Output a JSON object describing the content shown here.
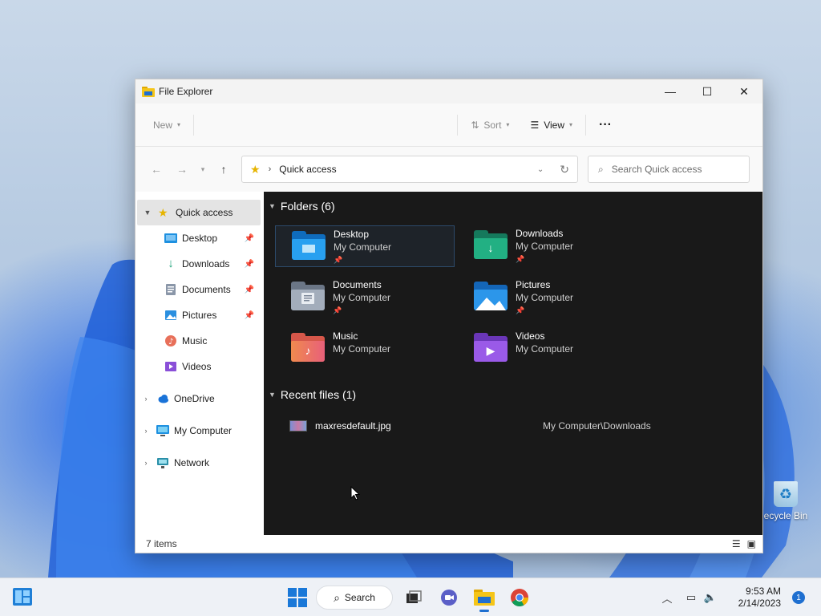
{
  "window": {
    "title": "File Explorer",
    "controls": {
      "minimize": "—",
      "maximize": "☐",
      "close": "✕"
    }
  },
  "toolbar": {
    "new_label": "New",
    "sort_label": "Sort",
    "view_label": "View",
    "more_label": "···"
  },
  "address_bar": {
    "location": "Quick access",
    "search_placeholder": "Search Quick access"
  },
  "sidebar": {
    "quick_access": "Quick access",
    "pinned": [
      {
        "label": "Desktop",
        "icon": "desktop-icon",
        "pinned": true
      },
      {
        "label": "Downloads",
        "icon": "downloads-icon",
        "pinned": true
      },
      {
        "label": "Documents",
        "icon": "documents-icon",
        "pinned": true
      },
      {
        "label": "Pictures",
        "icon": "pictures-icon",
        "pinned": true
      },
      {
        "label": "Music",
        "icon": "music-icon",
        "pinned": false
      },
      {
        "label": "Videos",
        "icon": "videos-icon",
        "pinned": false
      }
    ],
    "onedrive": "OneDrive",
    "my_computer": "My Computer",
    "network": "Network"
  },
  "content": {
    "folders_header": "Folders (6)",
    "folders": [
      {
        "name": "Desktop",
        "location": "My Computer",
        "pinned": true,
        "color": "#1e90e0"
      },
      {
        "name": "Downloads",
        "location": "My Computer",
        "pinned": true,
        "color": "#1fa37a"
      },
      {
        "name": "Documents",
        "location": "My Computer",
        "pinned": true,
        "color": "#8a96a8"
      },
      {
        "name": "Pictures",
        "location": "My Computer",
        "pinned": true,
        "color": "#2a8fe0"
      },
      {
        "name": "Music",
        "location": "My Computer",
        "pinned": false,
        "color": "#e8705a"
      },
      {
        "name": "Videos",
        "location": "My Computer",
        "pinned": false,
        "color": "#8a4fd8"
      }
    ],
    "recent_header": "Recent files (1)",
    "recent": [
      {
        "name": "maxresdefault.jpg",
        "path": "My Computer\\Downloads"
      }
    ]
  },
  "status": {
    "items": "7 items"
  },
  "desktop": {
    "recycle_bin": "ecycle Bin"
  },
  "taskbar": {
    "search_label": "Search",
    "time": "9:53 AM",
    "date": "2/14/2023",
    "notifications": "1"
  }
}
